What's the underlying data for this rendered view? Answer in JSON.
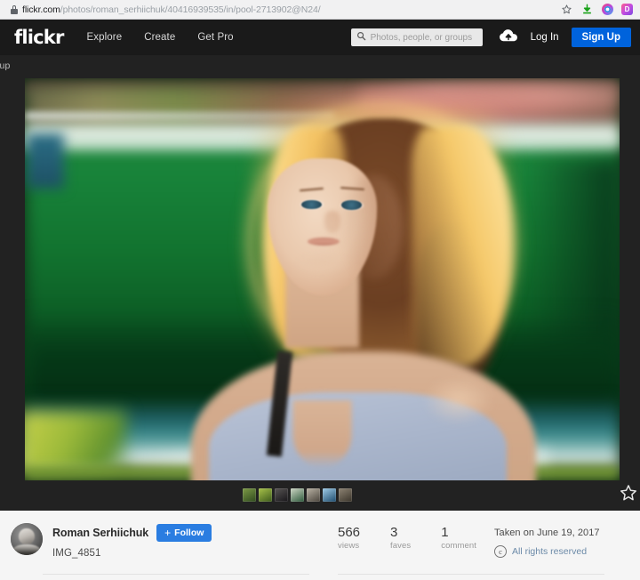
{
  "browser": {
    "url_host": "flickr.com",
    "url_path": "/photos/roman_serhiichuk/40416939535/in/pool-2713902@N24/",
    "lock_icon": "lock-icon",
    "bookmark_icon": "star-outline-icon",
    "download_icon": "download-arrow-icon",
    "extension_1_icon": "extension-circle-icon",
    "extension_2_icon": "extension-d-icon"
  },
  "header": {
    "logo": "flickr",
    "nav": [
      {
        "label": "Explore"
      },
      {
        "label": "Create"
      },
      {
        "label": "Get Pro"
      }
    ],
    "search": {
      "placeholder": "Photos, people, or groups",
      "value": "",
      "icon": "search-icon"
    },
    "upload_icon": "upload-cloud-icon",
    "login_label": "Log In",
    "signup_label": "Sign Up",
    "signup_color": "#0063dc"
  },
  "subbar": {
    "breadcrumb": "roup"
  },
  "photo": {
    "alt_description": "Backlit portrait of a young woman with curly golden-lit hair wearing a light blue-grey sleeveless top, blurred green park background",
    "favorite_icon": "star-outline-icon",
    "thumbnails": [
      {
        "name": "thumbnail-1",
        "color": "#4a5c2e"
      },
      {
        "name": "thumbnail-2",
        "color": "#6d8a35"
      },
      {
        "name": "thumbnail-3",
        "color": "#2a2a2c"
      },
      {
        "name": "thumbnail-4",
        "color": "#3d6b4a"
      },
      {
        "name": "thumbnail-5",
        "color": "#7d7a70"
      },
      {
        "name": "thumbnail-6",
        "color": "#2f6a8e"
      },
      {
        "name": "thumbnail-7",
        "color": "#5a5242"
      }
    ]
  },
  "info": {
    "owner_name": "Roman Serhiichuk",
    "follow_label": "Follow",
    "follow_plus": "+",
    "photo_title": "IMG_4851",
    "stats": [
      {
        "number": "566",
        "label": "views"
      },
      {
        "number": "3",
        "label": "faves"
      },
      {
        "number": "1",
        "label": "comment"
      }
    ],
    "taken_on": "Taken on June 19, 2017",
    "license_badge": "c",
    "license_text": "All rights reserved",
    "license_link_color": "#6b8aa8"
  }
}
